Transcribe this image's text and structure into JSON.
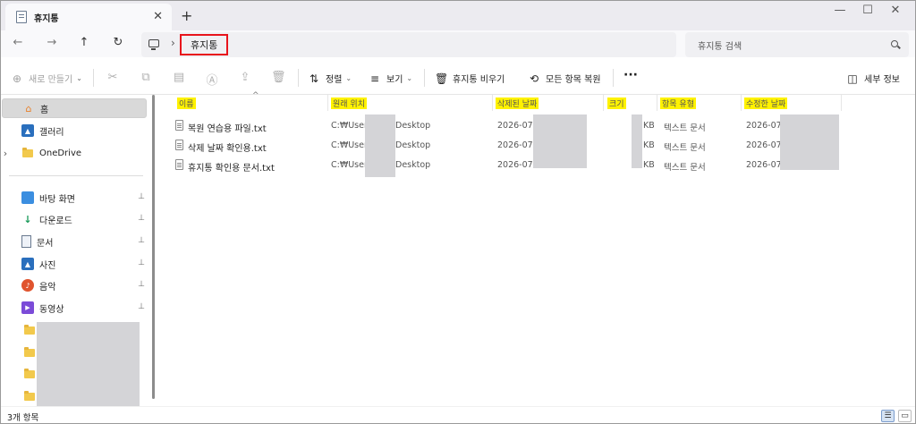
{
  "tab": {
    "title": "휴지통",
    "icon": "recycle-bin-icon",
    "close_glyph": "✕",
    "new_tab_glyph": "+"
  },
  "window_controls": {
    "minimize": "—",
    "maximize": "☐",
    "close": "✕"
  },
  "nav": {
    "back": "←",
    "forward": "→",
    "up": "↑",
    "refresh": "↻",
    "separator": "›"
  },
  "address": {
    "crumb": "휴지통",
    "highlight_color": "#e8141c"
  },
  "search": {
    "placeholder": "휴지통 검색"
  },
  "toolbar": {
    "new_label": "새로 만들기",
    "sort_label": "정렬",
    "view_label": "보기",
    "empty_bin_label": "휴지통 비우기",
    "restore_all_label": "모든 항목 복원",
    "more_label": "···",
    "details_label": "세부 정보"
  },
  "sidebar": {
    "home": "홈",
    "gallery": "갤러리",
    "onedrive": "OneDrive",
    "desktop": "바탕 화면",
    "downloads": "다운로드",
    "documents": "문서",
    "pictures": "사진",
    "music": "음악",
    "videos": "동영상",
    "pin_glyph": "📌",
    "expand_glyph": "›"
  },
  "columns": {
    "name": "이름",
    "original_location": "원래 위치",
    "date_deleted": "삭제된 날짜",
    "size": "크기",
    "item_type": "항목 유형",
    "date_modified": "수정한 날짜",
    "highlight_color": "#fff200"
  },
  "files": [
    {
      "name": "복원 연습용 파일.txt",
      "location_prefix": "C:₩Users",
      "location_suffix": "Desktop",
      "deleted": "2026-07-",
      "size_unit": "KB",
      "type": "텍스트 문서",
      "modified": "2026-07-"
    },
    {
      "name": "삭제 날짜 확인용.txt",
      "location_prefix": "C:₩Users",
      "location_suffix": "Desktop",
      "deleted": "2026-07-",
      "size_unit": "KB",
      "type": "텍스트 문서",
      "modified": "2026-07-"
    },
    {
      "name": "휴지통 확인용 문서.txt",
      "location_prefix": "C:₩Users",
      "location_suffix": "Desktop",
      "deleted": "2026-07-",
      "size_unit": "KB",
      "type": "텍스트 문서",
      "modified": "2026-07-"
    }
  ],
  "status": {
    "count": "3개 항목"
  }
}
